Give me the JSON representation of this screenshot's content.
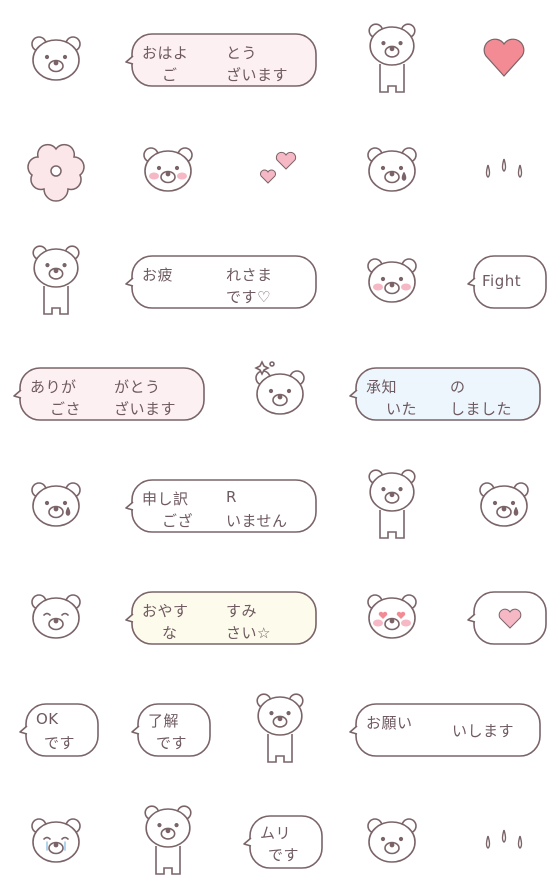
{
  "colors": {
    "line": "#7a6468",
    "blush": "#f5b8c4",
    "heart": "#f28b94",
    "pink_fill": "#fdf0f2",
    "blue_fill": "#eef6fd",
    "yellow_fill": "#fdfbec",
    "white_fill": "#ffffff"
  },
  "rows": [
    [
      {
        "type": "bear"
      },
      {
        "type": "bubble-left",
        "fill": "pink",
        "lines": [
          "おはよ",
          "ご"
        ]
      },
      {
        "type": "bubble-right",
        "fill": "pink",
        "lines": [
          "とう",
          "ざいます"
        ]
      },
      {
        "type": "bear-standing"
      },
      {
        "type": "heart"
      }
    ],
    [
      {
        "type": "flower"
      },
      {
        "type": "bear-blush"
      },
      {
        "type": "hearts"
      },
      {
        "type": "bear-sweat"
      },
      {
        "type": "drops"
      }
    ],
    [
      {
        "type": "bear-standing"
      },
      {
        "type": "bubble-left",
        "fill": "white",
        "lines": [
          "お疲",
          ""
        ]
      },
      {
        "type": "bubble-right",
        "fill": "white",
        "lines": [
          "れさま",
          "です♡"
        ]
      },
      {
        "type": "bear-blush"
      },
      {
        "type": "bubble-full",
        "fill": "white",
        "lines": [
          "Fight"
        ]
      }
    ],
    [
      {
        "type": "bubble-left",
        "fill": "pink",
        "lines": [
          "ありが",
          "ごさ"
        ]
      },
      {
        "type": "bubble-right",
        "fill": "pink",
        "lines": [
          "がとう",
          "ざいます"
        ]
      },
      {
        "type": "bear-sparkle"
      },
      {
        "type": "bubble-left",
        "fill": "blue",
        "lines": [
          "承知",
          "いた"
        ]
      },
      {
        "type": "bubble-right",
        "fill": "blue",
        "lines": [
          "の",
          "しました"
        ]
      }
    ],
    [
      {
        "type": "bear-sweat"
      },
      {
        "type": "bubble-left",
        "fill": "white",
        "lines": [
          "申し訳",
          "ござ"
        ]
      },
      {
        "type": "bubble-right",
        "fill": "white",
        "lines": [
          "R",
          "いません"
        ]
      },
      {
        "type": "bear-standing"
      },
      {
        "type": "bear-tear"
      }
    ],
    [
      {
        "type": "bear-sleepy"
      },
      {
        "type": "bubble-left",
        "fill": "yellow",
        "lines": [
          "おやす",
          "な"
        ]
      },
      {
        "type": "bubble-right",
        "fill": "yellow",
        "lines": [
          "すみ",
          "さい☆"
        ]
      },
      {
        "type": "bear-heart-eyes"
      },
      {
        "type": "heart-bubble"
      }
    ],
    [
      {
        "type": "bubble-full",
        "fill": "white",
        "lines": [
          "OK",
          "です"
        ]
      },
      {
        "type": "bubble-full",
        "fill": "white",
        "lines": [
          "了解",
          "です"
        ]
      },
      {
        "type": "bear-standing"
      },
      {
        "type": "bubble-left",
        "fill": "white",
        "lines": [
          "お願い",
          ""
        ]
      },
      {
        "type": "bubble-right",
        "fill": "white",
        "lines": [
          "いします",
          ""
        ]
      }
    ],
    [
      {
        "type": "bear-crying"
      },
      {
        "type": "bear-standing"
      },
      {
        "type": "bubble-full",
        "fill": "white",
        "lines": [
          "ムリ",
          "です"
        ]
      },
      {
        "type": "bear"
      },
      {
        "type": "drops"
      }
    ]
  ]
}
